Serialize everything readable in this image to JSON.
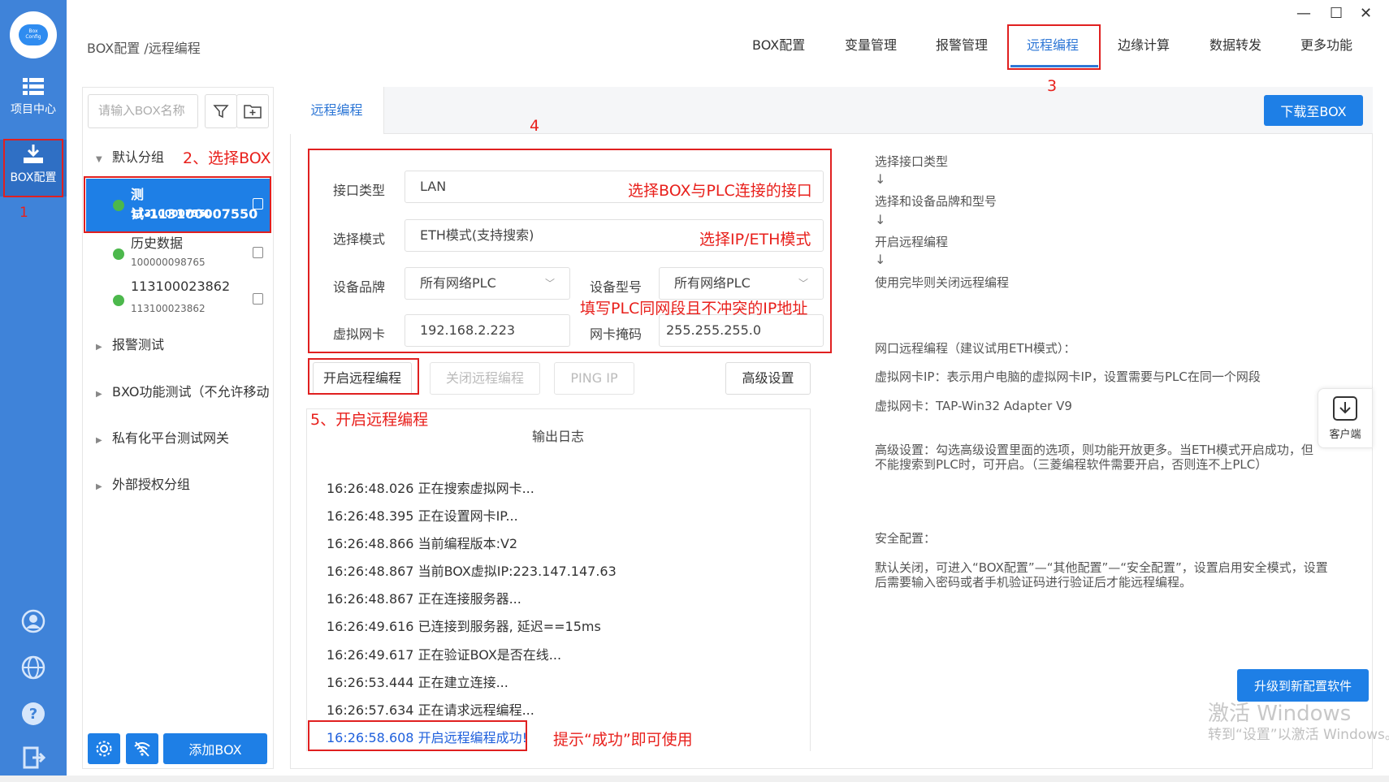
{
  "breadcrumb": "BOX配置 /远程编程",
  "window_controls": [
    "—",
    "☐",
    "✕"
  ],
  "rail": {
    "items": [
      {
        "label": "项目中心",
        "icon": "list-icon"
      },
      {
        "label": "BOX配置",
        "icon": "download-icon"
      }
    ],
    "bottom_icons": [
      "user-icon",
      "globe-icon",
      "help-icon",
      "logout-icon"
    ]
  },
  "topnav": [
    "BOX配置",
    "变量管理",
    "报警管理",
    "远程编程",
    "边缘计算",
    "数据转发",
    "更多功能"
  ],
  "left": {
    "search_placeholder": "请输入BOX名称",
    "groups": [
      "默认分组",
      "报警测试",
      "BXO功能测试（不允许移动",
      "私有化平台测试网关",
      "外部授权分组"
    ],
    "devices": [
      {
        "name": "测试-113100007550",
        "sn": "113100007550"
      },
      {
        "name": "历史数据",
        "sn": "100000098765"
      },
      {
        "name": "113100023862",
        "sn": "113100023862"
      }
    ],
    "add_button": "添加BOX"
  },
  "main": {
    "tab": "远程编程",
    "download_button": "下载至BOX",
    "form": {
      "interface_label": "接口类型",
      "interface_value": "LAN",
      "mode_label": "选择模式",
      "mode_value": "ETH模式(支持搜索)",
      "brand_label": "设备品牌",
      "brand_value": "所有网络PLC",
      "model_label": "设备型号",
      "model_value": "所有网络PLC",
      "nic_label": "虚拟网卡",
      "nic_value": "192.168.2.223",
      "mask_label": "网卡掩码",
      "mask_value": "255.255.255.0"
    },
    "buttons": {
      "start": "开启远程编程",
      "stop": "关闭远程编程",
      "ping": "PING IP",
      "advanced": "高级设置"
    },
    "log_title": "输出日志",
    "log": [
      "16:26:48.026 正在搜索虚拟网卡...",
      "16:26:48.395 正在设置网卡IP...",
      "16:26:48.866 当前编程版本:V2",
      "16:26:48.867 当前BOX虚拟IP:223.147.147.63",
      "16:26:48.867 正在连接服务器...",
      "16:26:49.616 已连接到服务器, 延迟==15ms",
      "16:26:49.617 正在验证BOX是否在线...",
      "16:26:53.444 正在建立连接...",
      "16:26:57.634 正在请求远程编程...",
      "16:26:58.608 开启远程编程成功!"
    ]
  },
  "help": {
    "steps": [
      "选择接口类型",
      "选择和设备品牌和型号",
      "开启远程编程",
      "使用完毕则关闭远程编程"
    ],
    "arrow": "↓",
    "p1": "网口远程编程（建议试用ETH模式）：",
    "p2": "虚拟网卡IP：表示用户电脑的虚拟网卡IP，设置需要与PLC在同一个网段",
    "p3": "虚拟网卡：TAP-Win32 Adapter V9",
    "p4a": "高级设置：勾选高级设置里面的选项，则功能开放更多。当ETH模式开启成功，但",
    "p4b": "不能搜索到PLC时，可开启。（三菱编程软件需要开启，否则连不上PLC）",
    "p5": "安全配置：",
    "p6a": "默认关闭，可进入“BOX配置”—“其他配置”—“安全配置”，设置启用安全模式，设置",
    "p6b": "后需要输入密码或者手机验证码进行验证后才能远程编程。"
  },
  "client_label": "客户端",
  "upgrade_button": "升级到新配置软件",
  "watermark": {
    "line1": "激活 Windows",
    "line2": "转到“设置”以激活 Windows。"
  },
  "annotations": {
    "n1": "1",
    "n2": "2、选择BOX",
    "n3": "3",
    "n4": "4",
    "n5": "5、开启远程编程",
    "a_interface": "选择BOX与PLC连接的接口",
    "a_mode": "选择IP/ETH模式",
    "a_ip": "填写PLC同网段且不冲突的IP地址",
    "a_success": "提示“成功”即可使用"
  },
  "colors": {
    "rail": "#3f83d9",
    "accent": "#1e7fe6",
    "annotation": "#e02020",
    "online": "#4cb84c"
  }
}
